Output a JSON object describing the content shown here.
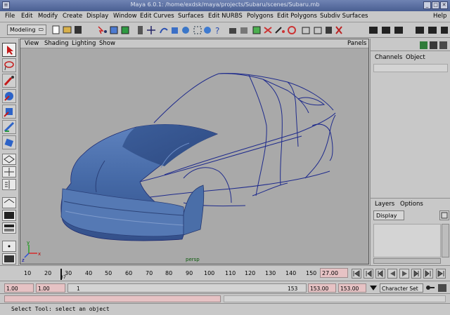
{
  "window": {
    "title": "Maya 6.0.1: /home/exdsk/maya/projects/Subaru/scenes/Subaru.mb",
    "buttons": [
      "_",
      "□",
      "✕"
    ]
  },
  "menubar": {
    "items": [
      "File",
      "Edit",
      "Modify",
      "Create",
      "Display",
      "Window",
      "Edit Curves",
      "Surfaces",
      "Edit NURBS",
      "Polygons",
      "Edit Polygons",
      "Subdiv Surfaces"
    ],
    "help": "Help"
  },
  "shelf": {
    "mode": "Modeling"
  },
  "viewport": {
    "menus": [
      "View",
      "Shading",
      "Lighting",
      "Show"
    ],
    "panels": "Panels",
    "camera_label": "persp",
    "axis_labels": [
      "x",
      "y",
      "z"
    ]
  },
  "channel_box": {
    "tabs": [
      "Channels",
      "Object"
    ]
  },
  "layer_editor": {
    "tabs": [
      "Layers",
      "Options"
    ],
    "display_select": "Display"
  },
  "time_slider": {
    "ticks": [
      "10",
      "20",
      "30",
      "40",
      "50",
      "60",
      "70",
      "80",
      "90",
      "100",
      "110",
      "120",
      "130",
      "140",
      "150"
    ],
    "current_frame_marker": "37",
    "current_time": "27.00"
  },
  "range_slider": {
    "start_time": "1.00",
    "playback_start": "1.00",
    "range_start": "1",
    "range_end": "153",
    "playback_end": "153.00",
    "end_time": "153.00",
    "character_set": "Character Set"
  },
  "help_line": {
    "text": "Select Tool: select an object"
  },
  "colors": {
    "title_bar": "#5a6da0",
    "viewport_bg": "#a9a9a9",
    "wire": "#1e2a8c",
    "surface": "#4a6ea8",
    "field_pink": "#e6c2c4"
  }
}
